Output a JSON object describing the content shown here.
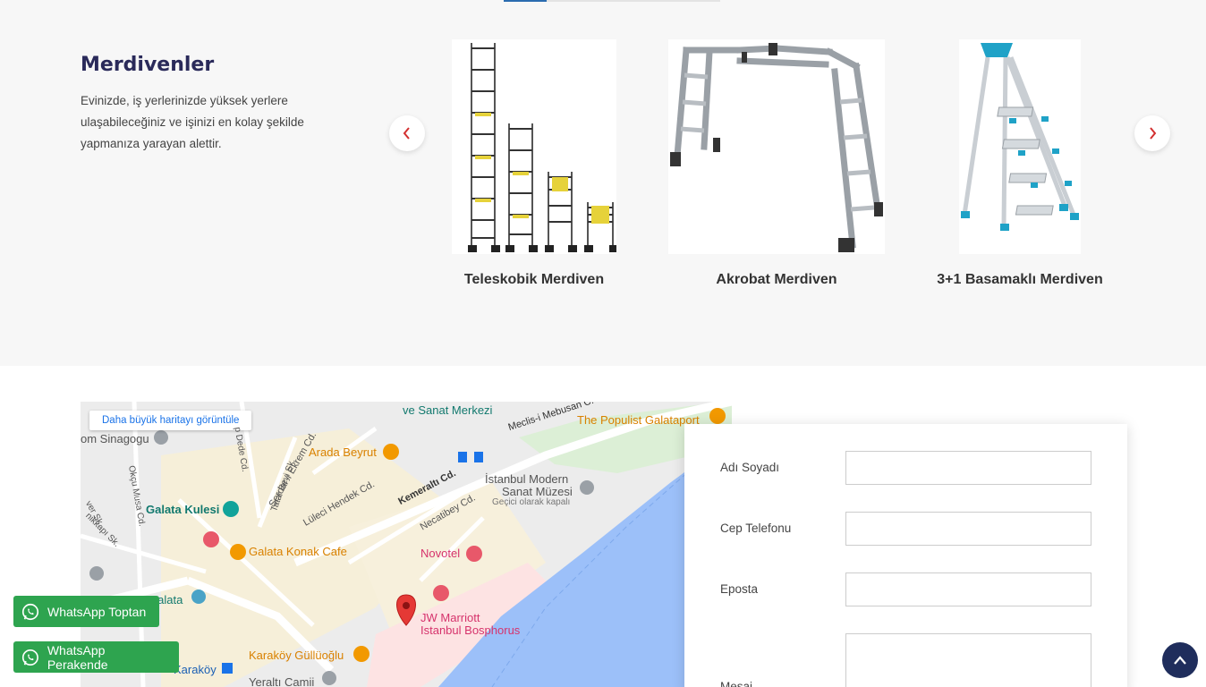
{
  "section": {
    "title": "Merdivenler",
    "description": "Evinizde, iş yerlerinizde yüksek yerlere ulaşabileceğiniz ve işinizi en kolay şekilde yapmanıza yarayan alettir."
  },
  "products": [
    {
      "name": "Teleskobik Merdiven"
    },
    {
      "name": "Akrobat Merdiven"
    },
    {
      "name": "3+1 Basamaklı Merdiven"
    }
  ],
  "map": {
    "link": "Daha büyük haritayı görüntüle",
    "labels": {
      "sanat_merkezi": "ve Sanat Merkezi",
      "meclis": "Meclis-i Mebusan C.",
      "populist": "The Populist Galataport",
      "sinagogu": "om Sinagogu",
      "arada": "Arada Beyrut",
      "serdar": "Serdar-ı Ekrem Cd.",
      "kemeralti": "Kemeraltı Cd.",
      "istanbul_modern_1": "İstanbul Modern",
      "istanbul_modern_2": "Sanat Müzesi",
      "istanbul_modern_3": "Geçici olarak kapalı",
      "galata_kulesi": "Galata Kulesi",
      "luleci": "Lüleci Hendek Cd.",
      "necatibey": "Necatibey Cd.",
      "galata_konak": "Galata Konak Cafe",
      "novotel": "Novotel",
      "jw_1": "JW Marriott",
      "jw_2": "Istanbul Bosphorus",
      "galata": "Galata",
      "karakoy_gulluoglu": "Karaköy Güllüoğlu",
      "karakoy": "Karaköy",
      "yeralti": "Yeraltı Camii",
      "okcu": "Okçu Musa Cd.",
      "dede": "p Dede Cd.",
      "tatar": "Tatar Beyi Sk.",
      "ver": "ver Sk.",
      "nikkapi": "nikkapı Sk."
    }
  },
  "form": {
    "name_label": "Adı Soyadı",
    "phone_label": "Cep Telefonu",
    "email_label": "Eposta",
    "message_label": "Mesaj"
  },
  "whatsapp": {
    "wholesale": "WhatsApp Toptan",
    "retail": "WhatsApp Perakende"
  },
  "colors": {
    "title": "#2a2a5a",
    "whatsapp": "#2ea44f",
    "scroll_top": "#1f2d5c",
    "water": "#9cc0f9",
    "map_pin": "#e53935"
  }
}
